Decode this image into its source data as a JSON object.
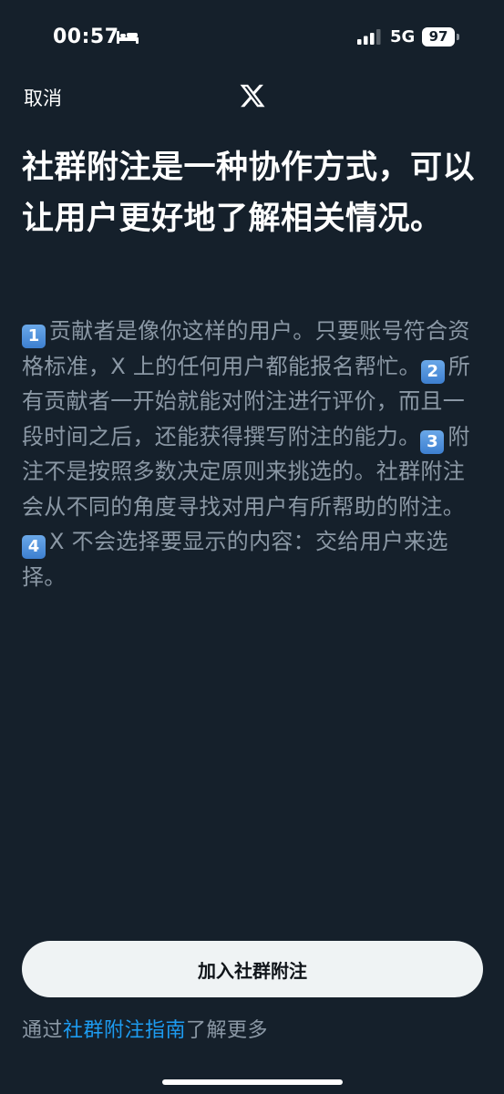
{
  "status_bar": {
    "time": "00:57",
    "network": "5G",
    "battery": "97"
  },
  "header": {
    "cancel_label": "取消",
    "logo": "x-logo"
  },
  "headline": "社群附注是一种协作方式，可以让用户更好地了解相关情况。",
  "body": {
    "items": [
      {
        "badge": "1",
        "text": "贡献者是像你这样的用户。只要账号符合资格标准，X 上的任何用户都能报名帮忙。"
      },
      {
        "badge": "2",
        "text": "所有贡献者一开始就能对附注进行评价，而且一段时间之后，还能获得撰写附注的能力。"
      },
      {
        "badge": "3",
        "text": "附注不是按照多数决定原则来挑选的。社群附注会从不同的角度寻找对用户有所帮助的附注。"
      },
      {
        "badge": "4",
        "text": "X 不会选择要显示的内容：交给用户来选择。"
      }
    ]
  },
  "join_button_label": "加入社群附注",
  "learn_more": {
    "prefix": "通过",
    "link": "社群附注指南",
    "suffix": "了解更多"
  },
  "colors": {
    "background": "#15202b",
    "link": "#1d9bf0",
    "muted_text": "#8b98a5",
    "button_bg": "#eff3f4"
  }
}
